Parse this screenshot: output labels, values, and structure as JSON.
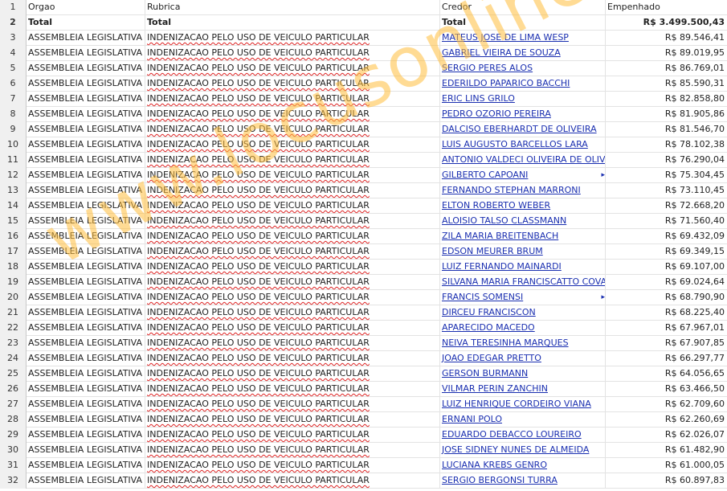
{
  "headers": {
    "rownum": "1",
    "orgao": "Orgao",
    "rubrica": "Rubrica",
    "credor": "Credor",
    "empenhado": "Empenhado"
  },
  "total": {
    "rownum": "2",
    "orgao": "Total",
    "rubrica": "Total",
    "credor": "Total",
    "empenhado": "R$ 3.499.500,43"
  },
  "rows": [
    {
      "n": "3",
      "orgao": "ASSEMBLEIA LEGISLATIVA",
      "rubrica": "INDENIZACAO PELO USO DE VEICULO PARTICULAR",
      "credor": "MATEUS JOSE DE LIMA WESP",
      "empenhado": "R$ 89.546,41"
    },
    {
      "n": "4",
      "orgao": "ASSEMBLEIA LEGISLATIVA",
      "rubrica": "INDENIZACAO PELO USO DE VEICULO PARTICULAR",
      "credor": "GABRIEL VIEIRA DE SOUZA",
      "empenhado": "R$ 89.019,95"
    },
    {
      "n": "5",
      "orgao": "ASSEMBLEIA LEGISLATIVA",
      "rubrica": "INDENIZACAO PELO USO DE VEICULO PARTICULAR",
      "credor": "SERGIO PERES ALOS",
      "empenhado": "R$ 86.769,01"
    },
    {
      "n": "6",
      "orgao": "ASSEMBLEIA LEGISLATIVA",
      "rubrica": "INDENIZACAO PELO USO DE VEICULO PARTICULAR",
      "credor": "EDERILDO PAPARICO BACCHI",
      "empenhado": "R$ 85.590,31"
    },
    {
      "n": "7",
      "orgao": "ASSEMBLEIA LEGISLATIVA",
      "rubrica": "INDENIZACAO PELO USO DE VEICULO PARTICULAR",
      "credor": "ERIC LINS GRILO",
      "empenhado": "R$ 82.858,80"
    },
    {
      "n": "8",
      "orgao": "ASSEMBLEIA LEGISLATIVA",
      "rubrica": "INDENIZACAO PELO USO DE VEICULO PARTICULAR",
      "credor": "PEDRO OZORIO PEREIRA",
      "empenhado": "R$ 81.905,86"
    },
    {
      "n": "9",
      "orgao": "ASSEMBLEIA LEGISLATIVA",
      "rubrica": "INDENIZACAO PELO USO DE VEICULO PARTICULAR",
      "credor": "DALCISO EBERHARDT DE OLIVEIRA",
      "empenhado": "R$ 81.546,70"
    },
    {
      "n": "10",
      "orgao": "ASSEMBLEIA LEGISLATIVA",
      "rubrica": "INDENIZACAO PELO USO DE VEICULO PARTICULAR",
      "credor": "LUIS AUGUSTO BARCELLOS LARA",
      "empenhado": "R$ 78.102,38"
    },
    {
      "n": "11",
      "orgao": "ASSEMBLEIA LEGISLATIVA",
      "rubrica": "INDENIZACAO PELO USO DE VEICULO PARTICULAR",
      "credor": "ANTONIO VALDECI OLIVEIRA DE OLIVE",
      "empenhado": "R$ 76.290,04"
    },
    {
      "n": "12",
      "orgao": "ASSEMBLEIA LEGISLATIVA",
      "rubrica": "INDENIZACAO PELO USO DE VEICULO PARTICULAR",
      "credor": "GILBERTO CAPOANI",
      "empenhado": "R$ 75.304,45"
    },
    {
      "n": "13",
      "orgao": "ASSEMBLEIA LEGISLATIVA",
      "rubrica": "INDENIZACAO PELO USO DE VEICULO PARTICULAR",
      "credor": "FERNANDO STEPHAN MARRONI",
      "empenhado": "R$ 73.110,45"
    },
    {
      "n": "14",
      "orgao": "ASSEMBLEIA LEGISLATIVA",
      "rubrica": "INDENIZACAO PELO USO DE VEICULO PARTICULAR",
      "credor": "ELTON ROBERTO WEBER",
      "empenhado": "R$ 72.668,20"
    },
    {
      "n": "15",
      "orgao": "ASSEMBLEIA LEGISLATIVA",
      "rubrica": "INDENIZACAO PELO USO DE VEICULO PARTICULAR",
      "credor": "ALOISIO TALSO CLASSMANN",
      "empenhado": "R$ 71.560,40"
    },
    {
      "n": "16",
      "orgao": "ASSEMBLEIA LEGISLATIVA",
      "rubrica": "INDENIZACAO PELO USO DE VEICULO PARTICULAR",
      "credor": "ZILA MARIA BREITENBACH",
      "empenhado": "R$ 69.432,09"
    },
    {
      "n": "17",
      "orgao": "ASSEMBLEIA LEGISLATIVA",
      "rubrica": "INDENIZACAO PELO USO DE VEICULO PARTICULAR",
      "credor": "EDSON MEURER BRUM",
      "empenhado": "R$ 69.349,15"
    },
    {
      "n": "18",
      "orgao": "ASSEMBLEIA LEGISLATIVA",
      "rubrica": "INDENIZACAO PELO USO DE VEICULO PARTICULAR",
      "credor": "LUIZ FERNANDO MAINARDI",
      "empenhado": "R$ 69.107,00"
    },
    {
      "n": "19",
      "orgao": "ASSEMBLEIA LEGISLATIVA",
      "rubrica": "INDENIZACAO PELO USO DE VEICULO PARTICULAR",
      "credor": "SILVANA MARIA FRANCISCATTO COVAT",
      "empenhado": "R$ 69.024,64"
    },
    {
      "n": "20",
      "orgao": "ASSEMBLEIA LEGISLATIVA",
      "rubrica": "INDENIZACAO PELO USO DE VEICULO PARTICULAR",
      "credor": "FRANCIS SOMENSI",
      "empenhado": "R$ 68.790,90"
    },
    {
      "n": "21",
      "orgao": "ASSEMBLEIA LEGISLATIVA",
      "rubrica": "INDENIZACAO PELO USO DE VEICULO PARTICULAR",
      "credor": "DIRCEU FRANCISCON",
      "empenhado": "R$ 68.225,40"
    },
    {
      "n": "22",
      "orgao": "ASSEMBLEIA LEGISLATIVA",
      "rubrica": "INDENIZACAO PELO USO DE VEICULO PARTICULAR",
      "credor": "APARECIDO MACEDO",
      "empenhado": "R$ 67.967,01"
    },
    {
      "n": "23",
      "orgao": "ASSEMBLEIA LEGISLATIVA",
      "rubrica": "INDENIZACAO PELO USO DE VEICULO PARTICULAR",
      "credor": "NEIVA TERESINHA MARQUES",
      "empenhado": "R$ 67.907,85"
    },
    {
      "n": "24",
      "orgao": "ASSEMBLEIA LEGISLATIVA",
      "rubrica": "INDENIZACAO PELO USO DE VEICULO PARTICULAR",
      "credor": "JOAO EDEGAR PRETTO",
      "empenhado": "R$ 66.297,77"
    },
    {
      "n": "25",
      "orgao": "ASSEMBLEIA LEGISLATIVA",
      "rubrica": "INDENIZACAO PELO USO DE VEICULO PARTICULAR",
      "credor": "GERSON BURMANN",
      "empenhado": "R$ 64.056,65"
    },
    {
      "n": "26",
      "orgao": "ASSEMBLEIA LEGISLATIVA",
      "rubrica": "INDENIZACAO PELO USO DE VEICULO PARTICULAR",
      "credor": "VILMAR PERIN ZANCHIN",
      "empenhado": "R$ 63.466,50"
    },
    {
      "n": "27",
      "orgao": "ASSEMBLEIA LEGISLATIVA",
      "rubrica": "INDENIZACAO PELO USO DE VEICULO PARTICULAR",
      "credor": "LUIZ HENRIQUE CORDEIRO VIANA",
      "empenhado": "R$ 62.709,60"
    },
    {
      "n": "28",
      "orgao": "ASSEMBLEIA LEGISLATIVA",
      "rubrica": "INDENIZACAO PELO USO DE VEICULO PARTICULAR",
      "credor": "ERNANI POLO",
      "empenhado": "R$ 62.260,69"
    },
    {
      "n": "29",
      "orgao": "ASSEMBLEIA LEGISLATIVA",
      "rubrica": "INDENIZACAO PELO USO DE VEICULO PARTICULAR",
      "credor": "EDUARDO DEBACCO LOUREIRO",
      "empenhado": "R$ 62.026,07"
    },
    {
      "n": "30",
      "orgao": "ASSEMBLEIA LEGISLATIVA",
      "rubrica": "INDENIZACAO PELO USO DE VEICULO PARTICULAR",
      "credor": "JOSE SIDNEY NUNES DE ALMEIDA",
      "empenhado": "R$ 61.482,90"
    },
    {
      "n": "31",
      "orgao": "ASSEMBLEIA LEGISLATIVA",
      "rubrica": "INDENIZACAO PELO USO DE VEICULO PARTICULAR",
      "credor": "LUCIANA KREBS GENRO",
      "empenhado": "R$ 61.000,05"
    },
    {
      "n": "32",
      "orgao": "ASSEMBLEIA LEGISLATIVA",
      "rubrica": "INDENIZACAO PELO USO DE VEICULO PARTICULAR",
      "credor": "SERGIO BERGONSI TURRA",
      "empenhado": "R$ 60.897,83"
    }
  ],
  "truncated_rows": [
    9,
    17
  ],
  "watermark": "www.locusonline.com.br",
  "colors": {
    "link": "#1a2fb0",
    "watermark": "#ffbe3c",
    "rowheader_bg": "#f0f0f0"
  }
}
